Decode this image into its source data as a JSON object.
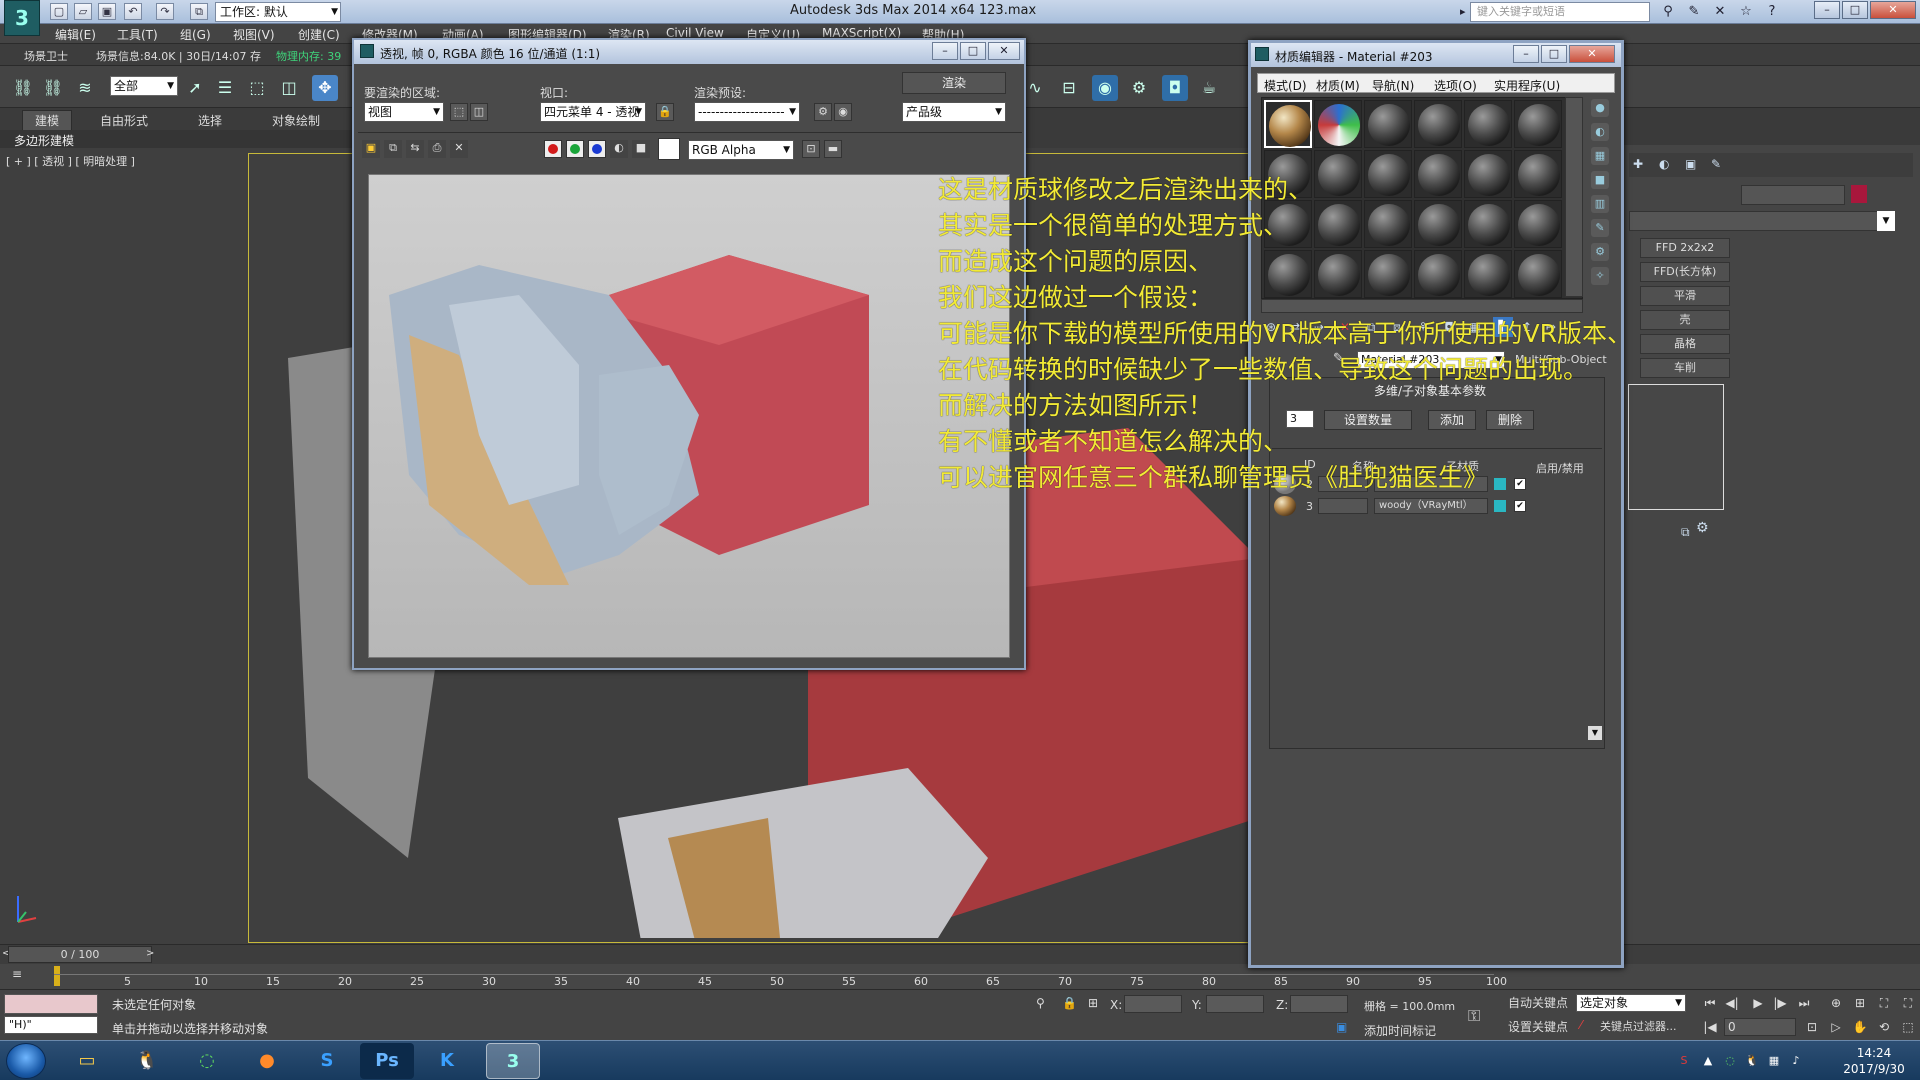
{
  "app": {
    "title": "Autodesk 3ds Max  2014 x64     123.max",
    "workspace": "工作区: 默认",
    "search_placeholder": "键入关键字或短语"
  },
  "menubar": [
    "编辑(E)",
    "工具(T)",
    "组(G)",
    "视图(V)",
    "创建(C)",
    "修改器(M)",
    "动画(A)",
    "图形编辑器(D)",
    "渲染(R)",
    "Civil View",
    "自定义(U)",
    "MAXScript(X)",
    "帮助(H)"
  ],
  "infobar": {
    "scene_explorer": "场景卫士",
    "scene_info": "场景信息:84.0K | 30日/14:07 存",
    "memory": "物理内存: 39"
  },
  "toolbar": {
    "selection_filter": "全部"
  },
  "ribbon": {
    "tabs": [
      "建模",
      "自由形式",
      "选择",
      "对象绘制"
    ],
    "sub_label": "多边形建模"
  },
  "viewport": {
    "label": "[ + ] [ 透视 ] [ 明暗处理 ]"
  },
  "note": {
    "lines": [
      "这是材质球修改之后渲染出来的、",
      "其实是一个很简单的处理方式、",
      "而造成这个问题的原因、",
      "我们这边做过一个假设：",
      "可能是你下载的模型所使用的VR版本高于你所使用的VR版本、",
      "在代码转换的时候缺少了一些数值、导致这个问题的出现。",
      "而解决的方法如图所示！",
      "有不懂或者不知道怎么解决的、",
      "可以进官网任意三个群私聊管理员《肚兜猫医生》"
    ]
  },
  "render_window": {
    "title": "透视, 帧 0, RGBA 颜色 16 位/通道 (1:1)",
    "area_label": "要渲染的区域:",
    "area_value": "视图",
    "viewport_label": "视口:",
    "viewport_value": "四元菜单 4 - 透视",
    "preset_label": "渲染预设:",
    "preset_value": "--------------------",
    "render_button": "渲染",
    "level_value": "产品级",
    "channel_value": "RGB Alpha"
  },
  "material_editor": {
    "title": "材质编辑器 - Material #203",
    "menus": [
      "模式(D)",
      "材质(M)",
      "导航(N)",
      "选项(O)",
      "实用程序(U)"
    ],
    "material_name": "Material #203",
    "material_type": "Multi/Sub-Object",
    "rollout_title": "多维/子对象基本参数",
    "count_value": "3",
    "set_count_button": "设置数量",
    "add_button": "添加",
    "delete_button": "删除",
    "headers": [
      "ID",
      "名称",
      "子材质",
      "启用/禁用"
    ],
    "rows": [
      {
        "id": "2",
        "sub": "",
        "color": "#2ab7c2"
      },
      {
        "id": "3",
        "sub": "woody（VRayMtl）",
        "color": "#2ab7c2"
      }
    ]
  },
  "command_panel": {
    "buttons": [
      "FFD 2x2x2",
      "FFD(长方体)",
      "平滑",
      "壳",
      "晶格",
      "车削"
    ]
  },
  "timeline": {
    "thumb": "0 / 100",
    "ticks": [
      "5",
      "10",
      "15",
      "20",
      "25",
      "30",
      "35",
      "40",
      "45",
      "50",
      "55",
      "60",
      "65",
      "70",
      "75",
      "80",
      "85",
      "90",
      "95",
      "100"
    ]
  },
  "statusbar": {
    "listener_text": "\"H)\"",
    "status_line1": "未选定任何对象",
    "status_line2": "单击并拖动以选择并移动对象",
    "x_label": "X:",
    "y_label": "Y:",
    "z_label": "Z:",
    "grid": "栅格 = 100.0mm",
    "add_time_tag": "添加时间标记",
    "auto_key": "自动关键点",
    "selected_object": "选定对象",
    "set_key": "设置关键点",
    "key_filter": "关键点过滤器...",
    "frame_value": "0"
  },
  "taskbar": {
    "time": "14:24",
    "date": "2017/9/30"
  }
}
